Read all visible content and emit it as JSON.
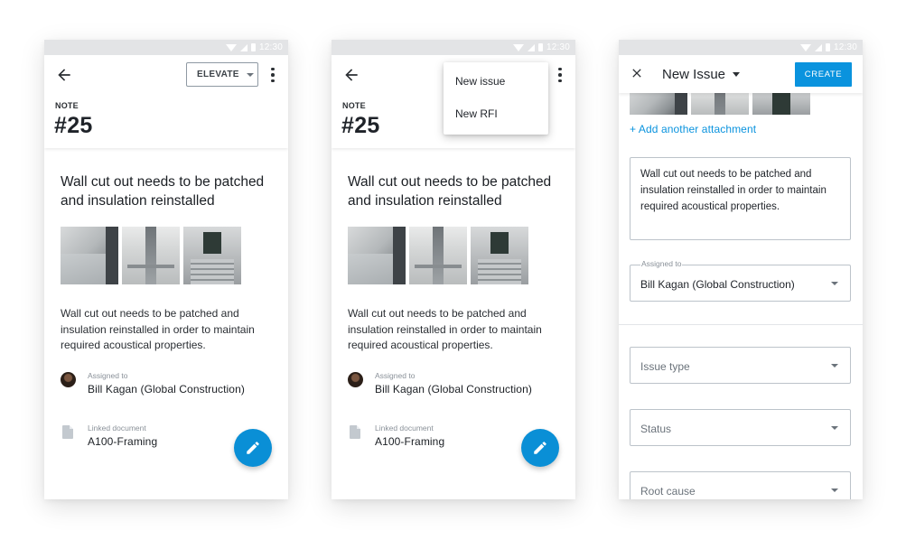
{
  "status_bar": {
    "time": "12:30"
  },
  "screen1": {
    "elevate_label": "ELEVATE",
    "note_label": "NOTE",
    "note_number": "#25",
    "title": "Wall cut out needs to be patched and insulation reinstalled",
    "description": "Wall cut out needs to be patched and insulation reinstalled in order to maintain required acoustical properties.",
    "assigned_label": "Assigned to",
    "assigned_value": "Bill Kagan (Global Construction)",
    "linked_label": "Linked document",
    "linked_value": "A100-Framing"
  },
  "screen2": {
    "note_label": "NOTE",
    "note_number": "#25",
    "menu": [
      "New issue",
      "New RFI"
    ],
    "title": "Wall cut out needs to be patched and insulation reinstalled",
    "description": "Wall cut out needs to be patched and insulation reinstalled in order to maintain required acoustical properties.",
    "assigned_label": "Assigned to",
    "assigned_value": "Bill Kagan (Global Construction)",
    "linked_label": "Linked document",
    "linked_value": "A100-Framing"
  },
  "screen3": {
    "title": "New Issue",
    "create_label": "CREATE",
    "add_attachment": "+ Add another attachment",
    "description": "Wall cut out needs to be patched and insulation reinstalled in order to maintain required acoustical properties.",
    "assigned_label": "Assigned to",
    "assigned_value": "Bill Kagan (Global Construction)",
    "issue_type_placeholder": "Issue type",
    "status_placeholder": "Status",
    "root_cause_placeholder": "Root cause"
  },
  "colors": {
    "accent": "#0a93de",
    "fab": "#0a8fd6",
    "statusbar": "#e3e4e6"
  }
}
